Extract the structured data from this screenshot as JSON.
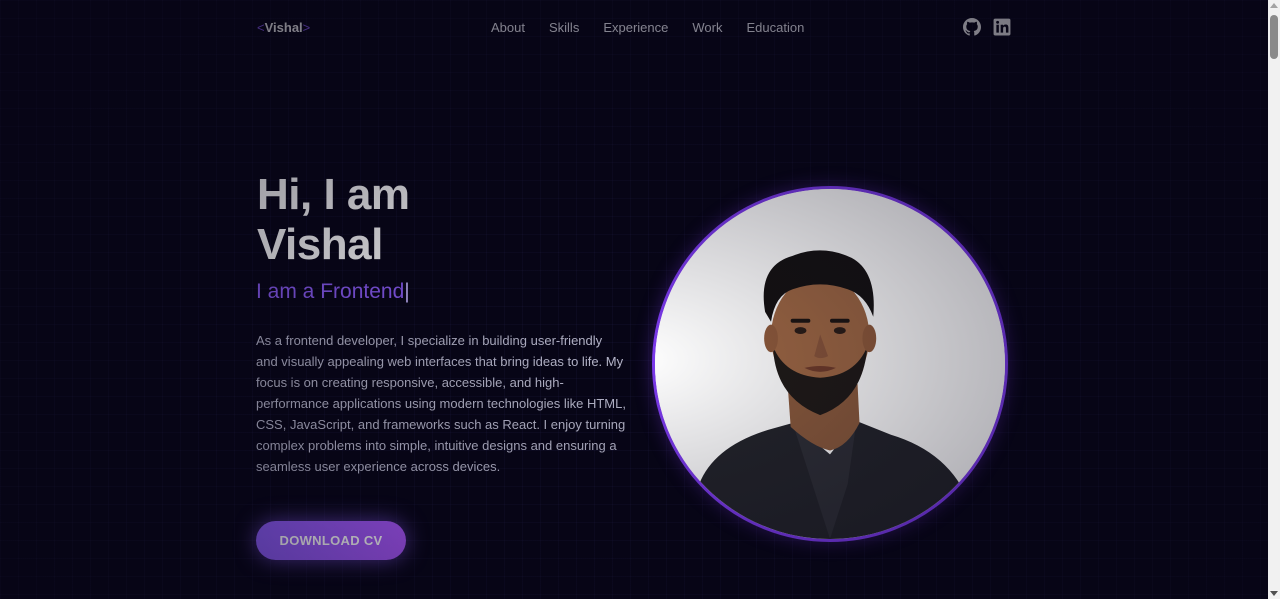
{
  "header": {
    "logo_open": "<",
    "logo_name": "Vishal",
    "logo_close": ">",
    "nav": [
      {
        "label": "About"
      },
      {
        "label": "Skills"
      },
      {
        "label": "Experience"
      },
      {
        "label": "Work"
      },
      {
        "label": "Education"
      }
    ],
    "social_icons": [
      "github-icon",
      "linkedin-icon"
    ]
  },
  "hero": {
    "greeting_line1": "Hi, I am",
    "greeting_line2": "Vishal",
    "role_prefix": "I am a ",
    "role_typed": "Frontend",
    "cursor": "|",
    "bio": "As a frontend developer, I specialize in building user-friendly and visually appealing web interfaces that bring ideas to life. My focus is on creating responsive, accessible, and high-performance applications using modern technologies like HTML, CSS, JavaScript, and frameworks such as React. I enjoy turning complex problems into simple, intuitive designs and ensuring a seamless user experience across devices.",
    "cv_button_label": "DOWNLOAD CV"
  },
  "colors": {
    "background": "#070516",
    "accent": "#8b5cf6",
    "portrait_border": "#7c3aed"
  }
}
